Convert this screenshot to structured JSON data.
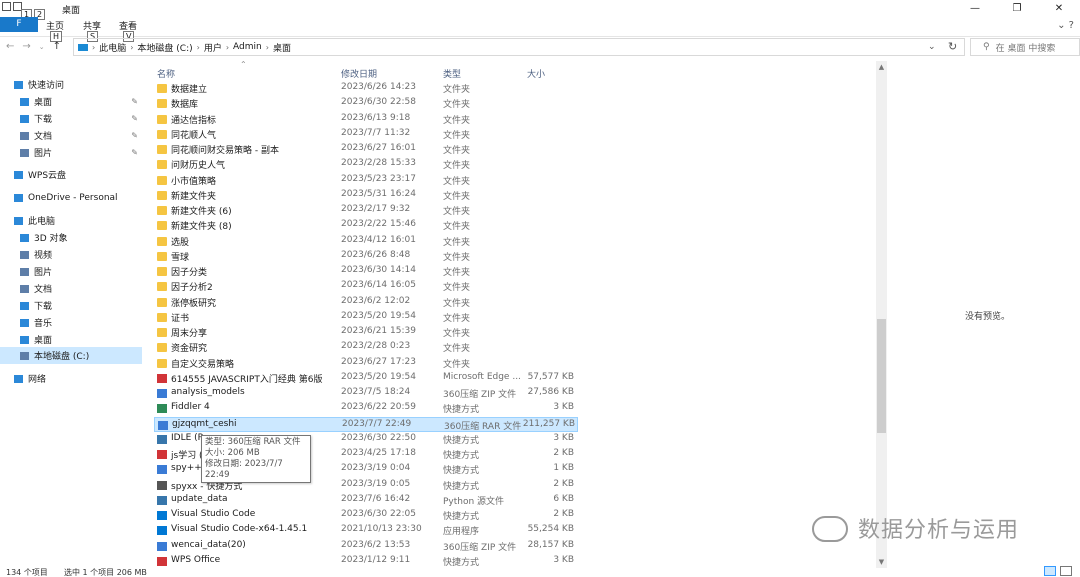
{
  "window": {
    "title": "桌面",
    "keytips": [
      "1",
      "2"
    ],
    "controls": [
      "—",
      "❐",
      "✕"
    ]
  },
  "ribbon": {
    "file_label": "F",
    "tabs": [
      {
        "label": "主页",
        "key": "H"
      },
      {
        "label": "共享",
        "key": "S"
      },
      {
        "label": "查看",
        "key": "V"
      }
    ],
    "expand": "⌄ ?"
  },
  "address": {
    "crumbs": [
      "此电脑",
      "本地磁盘 (C:)",
      "用户",
      "Admin",
      "桌面"
    ],
    "search_placeholder": "在 桌面 中搜索"
  },
  "navpane": {
    "items": [
      {
        "label": "快速访问",
        "icon": "star-icon",
        "color": "#2b88d8",
        "pinned": false
      },
      {
        "label": "桌面",
        "icon": "desktop-icon",
        "color": "#2b88d8",
        "pinned": true
      },
      {
        "label": "下载",
        "icon": "download-icon",
        "color": "#2b88d8",
        "pinned": true
      },
      {
        "label": "文档",
        "icon": "document-icon",
        "color": "#5e7ea8",
        "pinned": true
      },
      {
        "label": "图片",
        "icon": "picture-icon",
        "color": "#5e7ea8",
        "pinned": true
      },
      {
        "label": "WPS云盘",
        "icon": "cloud-icon",
        "color": "#2b88d8",
        "pinned": false
      },
      {
        "label": "OneDrive - Personal",
        "icon": "cloud-icon",
        "color": "#2b88d8",
        "pinned": false
      },
      {
        "label": "此电脑",
        "icon": "computer-icon",
        "color": "#2b88d8",
        "pinned": false
      },
      {
        "label": "3D 对象",
        "icon": "cube-icon",
        "color": "#2b88d8",
        "pinned": false
      },
      {
        "label": "视频",
        "icon": "video-icon",
        "color": "#5e7ea8",
        "pinned": false
      },
      {
        "label": "图片",
        "icon": "picture-icon",
        "color": "#5e7ea8",
        "pinned": false
      },
      {
        "label": "文档",
        "icon": "document-icon",
        "color": "#5e7ea8",
        "pinned": false
      },
      {
        "label": "下载",
        "icon": "download-icon",
        "color": "#2b88d8",
        "pinned": false
      },
      {
        "label": "音乐",
        "icon": "music-icon",
        "color": "#2b88d8",
        "pinned": false
      },
      {
        "label": "桌面",
        "icon": "desktop-icon",
        "color": "#2b88d8",
        "pinned": false
      },
      {
        "label": "本地磁盘 (C:)",
        "icon": "drive-icon",
        "color": "#5e7ea8",
        "pinned": false
      },
      {
        "label": "网络",
        "icon": "network-icon",
        "color": "#2b88d8",
        "pinned": false
      }
    ]
  },
  "columns": {
    "name": "名称",
    "date": "修改日期",
    "type": "类型",
    "size": "大小"
  },
  "files": [
    {
      "name": "数据建立",
      "date": "2023/6/26 14:23",
      "type": "文件夹",
      "size": "",
      "kind": "folder"
    },
    {
      "name": "数据库",
      "date": "2023/6/30 22:58",
      "type": "文件夹",
      "size": "",
      "kind": "folder"
    },
    {
      "name": "通达信指标",
      "date": "2023/6/13 9:18",
      "type": "文件夹",
      "size": "",
      "kind": "folder"
    },
    {
      "name": "同花顺人气",
      "date": "2023/7/7 11:32",
      "type": "文件夹",
      "size": "",
      "kind": "folder"
    },
    {
      "name": "同花顺问财交易策略 - 副本",
      "date": "2023/6/27 16:01",
      "type": "文件夹",
      "size": "",
      "kind": "folder"
    },
    {
      "name": "问财历史人气",
      "date": "2023/2/28 15:33",
      "type": "文件夹",
      "size": "",
      "kind": "folder"
    },
    {
      "name": "小市值策略",
      "date": "2023/5/23 23:17",
      "type": "文件夹",
      "size": "",
      "kind": "folder"
    },
    {
      "name": "新建文件夹",
      "date": "2023/5/31 16:24",
      "type": "文件夹",
      "size": "",
      "kind": "folder"
    },
    {
      "name": "新建文件夹 (6)",
      "date": "2023/2/17 9:32",
      "type": "文件夹",
      "size": "",
      "kind": "folder"
    },
    {
      "name": "新建文件夹 (8)",
      "date": "2023/2/22 15:46",
      "type": "文件夹",
      "size": "",
      "kind": "folder"
    },
    {
      "name": "选股",
      "date": "2023/4/12 16:01",
      "type": "文件夹",
      "size": "",
      "kind": "folder"
    },
    {
      "name": "雪球",
      "date": "2023/6/26 8:48",
      "type": "文件夹",
      "size": "",
      "kind": "folder"
    },
    {
      "name": "因子分类",
      "date": "2023/6/30 14:14",
      "type": "文件夹",
      "size": "",
      "kind": "folder"
    },
    {
      "name": "因子分析2",
      "date": "2023/6/14 16:05",
      "type": "文件夹",
      "size": "",
      "kind": "folder"
    },
    {
      "name": "涨停板研究",
      "date": "2023/6/2 12:02",
      "type": "文件夹",
      "size": "",
      "kind": "folder"
    },
    {
      "name": "证书",
      "date": "2023/5/20 19:54",
      "type": "文件夹",
      "size": "",
      "kind": "folder"
    },
    {
      "name": "周末分享",
      "date": "2023/6/21 15:39",
      "type": "文件夹",
      "size": "",
      "kind": "folder"
    },
    {
      "name": "资金研究",
      "date": "2023/2/28 0:23",
      "type": "文件夹",
      "size": "",
      "kind": "folder"
    },
    {
      "name": "自定义交易策略",
      "date": "2023/6/27 17:23",
      "type": "文件夹",
      "size": "",
      "kind": "folder"
    },
    {
      "name": "614555 JAVASCRIPT入门经典 第6版",
      "date": "2023/5/20 19:54",
      "type": "Microsoft Edge ...",
      "size": "57,577 KB",
      "kind": "pdf"
    },
    {
      "name": "analysis_models",
      "date": "2023/7/5 18:24",
      "type": "360压缩 ZIP 文件",
      "size": "27,586 KB",
      "kind": "archive"
    },
    {
      "name": "Fiddler 4",
      "date": "2023/6/22 20:59",
      "type": "快捷方式",
      "size": "3 KB",
      "kind": "shortcut"
    },
    {
      "name": "gjzqqmt_ceshi",
      "date": "2023/7/7 22:49",
      "type": "360压缩 RAR 文件",
      "size": "211,257 KB",
      "kind": "archive",
      "selected": true
    },
    {
      "name": "IDLE (Py",
      "date": "2023/6/30 22:50",
      "type": "快捷方式",
      "size": "3 KB",
      "kind": "python"
    },
    {
      "name": "js学习 (1",
      "date": "2023/4/25 17:18",
      "type": "快捷方式",
      "size": "2 KB",
      "kind": "js"
    },
    {
      "name": "spy++",
      "date": "2023/3/19 0:04",
      "type": "快捷方式",
      "size": "1 KB",
      "kind": "app"
    },
    {
      "name": "spyxx - 快捷方式",
      "date": "2023/3/19 0:05",
      "type": "快捷方式",
      "size": "2 KB",
      "kind": "app2"
    },
    {
      "name": "update_data",
      "date": "2023/7/6 16:42",
      "type": "Python 源文件",
      "size": "6 KB",
      "kind": "pyfile"
    },
    {
      "name": "Visual Studio Code",
      "date": "2023/6/30 22:05",
      "type": "快捷方式",
      "size": "2 KB",
      "kind": "vscode"
    },
    {
      "name": "Visual Studio Code-x64-1.45.1",
      "date": "2021/10/13 23:30",
      "type": "应用程序",
      "size": "55,254 KB",
      "kind": "vscode"
    },
    {
      "name": "wencai_data(20)",
      "date": "2023/6/2 13:53",
      "type": "360压缩 ZIP 文件",
      "size": "28,157 KB",
      "kind": "archive"
    },
    {
      "name": "WPS Office",
      "date": "2023/1/12 9:11",
      "type": "快捷方式",
      "size": "3 KB",
      "kind": "wps"
    }
  ],
  "tooltip": {
    "type": "类型: 360压缩 RAR 文件",
    "size": "大小: 206 MB",
    "date": "修改日期: 2023/7/7 22:49"
  },
  "preview": {
    "message": "没有预览。"
  },
  "watermark": "数据分析与运用",
  "status": {
    "count": "134 个项目",
    "selection": "选中 1 个项目 206 MB"
  }
}
